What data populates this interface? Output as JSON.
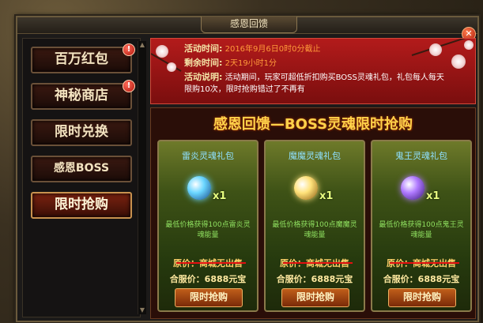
{
  "background": {
    "title": "",
    "subtitle": ""
  },
  "window": {
    "title": "感恩回馈",
    "close_icon": "close-icon"
  },
  "sidebar": {
    "items": [
      {
        "label": "百万红包",
        "badge": "!",
        "active": false
      },
      {
        "label": "神秘商店",
        "badge": "!",
        "active": false
      },
      {
        "label": "限时兑换",
        "badge": "",
        "active": false
      },
      {
        "label": "感恩BOSS",
        "badge": "",
        "active": false
      },
      {
        "label": "限时抢购",
        "badge": "",
        "active": true
      }
    ]
  },
  "info": {
    "time_label": "活动时间:",
    "time_value": "2016年9月6日0时0分截止",
    "remain_label": "剩余时间:",
    "remain_value": "2天19小时1分",
    "desc_label": "活动说明:",
    "desc_line1": "活动期间，玩家可超低折扣购买BOSS灵魂礼包，礼包每人每天",
    "desc_line2": "限购10次，限时抢购错过了不再有"
  },
  "promo": {
    "title": "感恩回馈—BOSS灵魂限时抢购",
    "cards": [
      {
        "name": "雷炎灵魂礼包",
        "qty": "x1",
        "desc": "最低价格获得100点雷炎灵魂能量",
        "orig": "原价：商城无出售",
        "price": "合服价：6888元宝",
        "button": "限时抢购",
        "orb_color": "#6ad6ff"
      },
      {
        "name": "魔魔灵魂礼包",
        "qty": "x1",
        "desc": "最低价格获得100点魔魔灵魂能量",
        "orig": "原价：商城无出售",
        "price": "合服价：6888元宝",
        "button": "限时抢购",
        "orb_color": "#ffe27a"
      },
      {
        "name": "鬼王灵魂礼包",
        "qty": "x1",
        "desc": "最低价格获得100点鬼王灵魂能量",
        "orig": "原价：商城无出售",
        "price": "合服价：6888元宝",
        "button": "限时抢购",
        "orb_color": "#b07aff"
      }
    ]
  }
}
